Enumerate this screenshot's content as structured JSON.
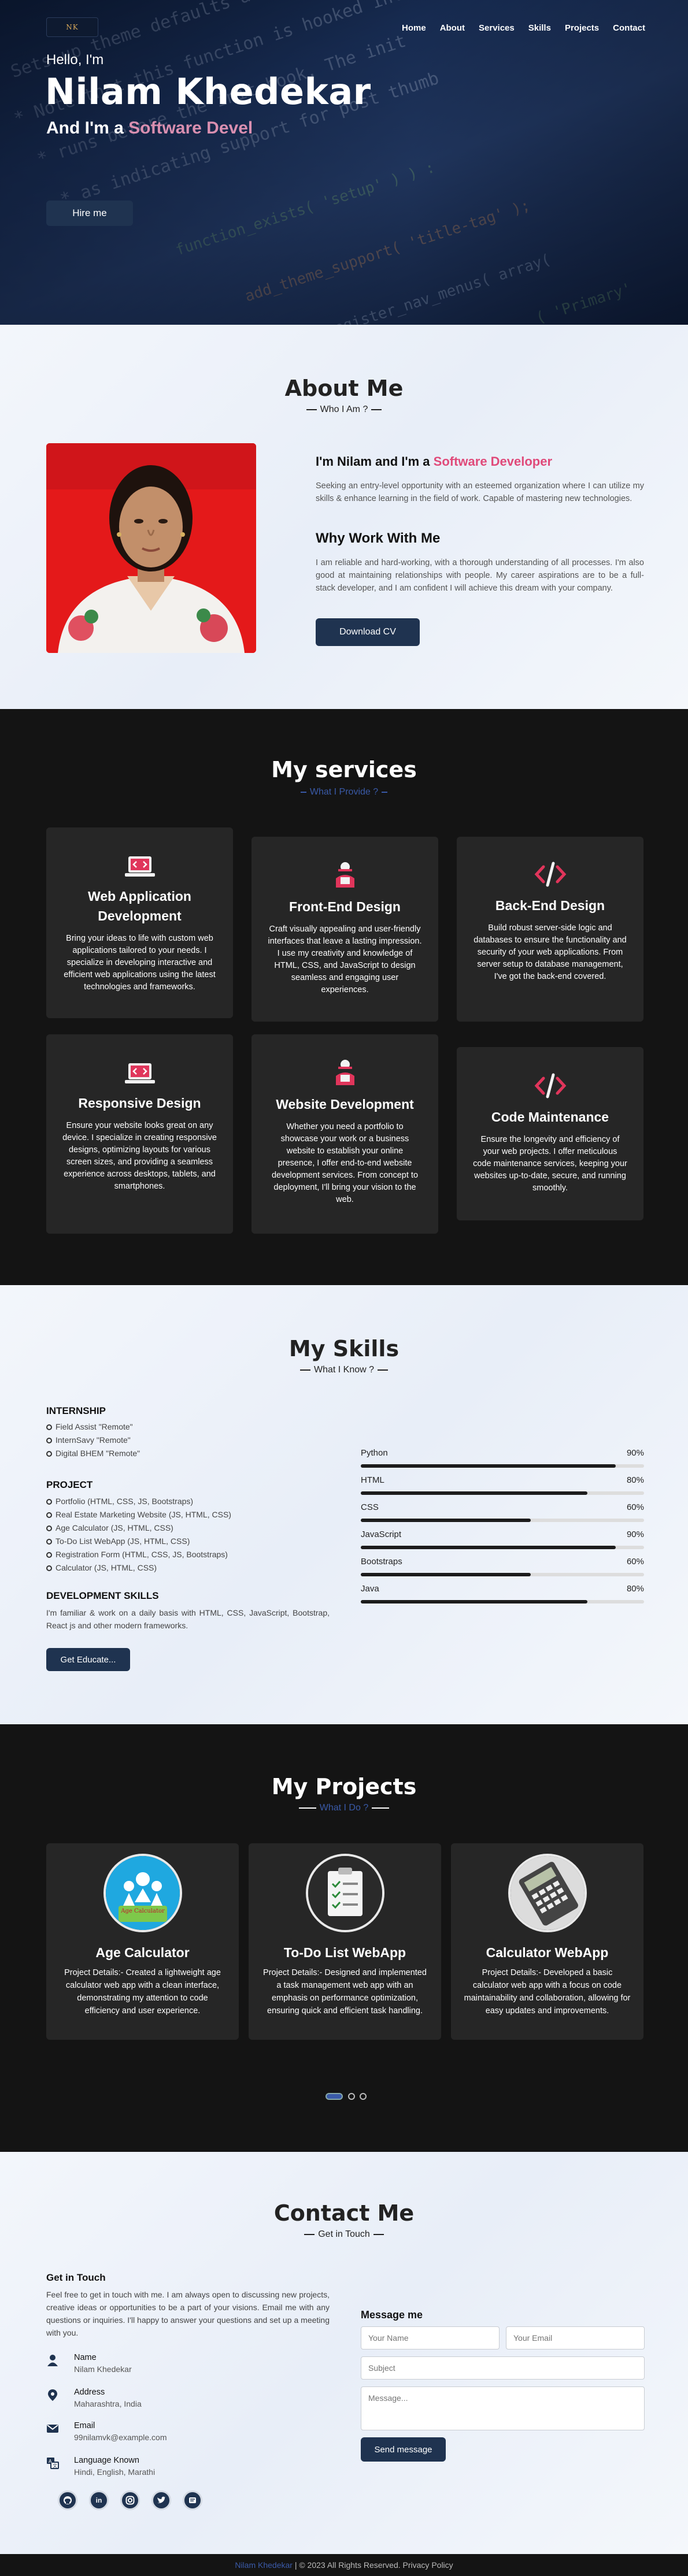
{
  "nav": {
    "logo_text": "NK",
    "items": [
      "Home",
      "About",
      "Services",
      "Skills",
      "Projects",
      "Contact"
    ]
  },
  "hero": {
    "greeting": "Hello, I'm",
    "name": "Nilam Khedekar",
    "role_prefix": "And I'm a ",
    "role_typed": "Software Devel",
    "hire_label": "Hire me"
  },
  "about": {
    "title": "About Me",
    "subtitle": "Who I Am ?",
    "intro_prefix": "I'm Nilam and I'm a ",
    "intro_typed": "Software Developer",
    "intro_p": "Seeking an entry-level opportunity with an esteemed organization where I can utilize my skills & enhance learning in the field of work. Capable of mastering new technologies.",
    "why_title": "Why Work With Me",
    "why_p": "I am reliable and hard-working, with a thorough understanding of all processes. I'm also good at maintaining relationships with people. My career aspirations are to be a full-stack developer, and I am confident I will achieve this dream with your company.",
    "cv_label": "Download CV"
  },
  "services": {
    "title": "My services",
    "subtitle": "What I Provide ?",
    "accent": "#3a5aa8",
    "items": [
      {
        "title": "Web Application Development",
        "desc": "Bring your ideas to life with custom web applications tailored to your needs. I specialize in developing interactive and efficient web applications using the latest technologies and frameworks.",
        "icon": "laptop-code-icon"
      },
      {
        "title": "Front-End Design",
        "desc": "Craft visually appealing and user-friendly interfaces that leave a lasting impression. I use my creativity and knowledge of HTML, CSS, and JavaScript to design seamless and engaging user experiences.",
        "icon": "designer-icon"
      },
      {
        "title": "Back-End Design",
        "desc": "Build robust server-side logic and databases to ensure the functionality and security of your web applications. From server setup to database management, I've got the back-end covered.",
        "icon": "code-icon"
      },
      {
        "title": "Responsive Design",
        "desc": "Ensure your website looks great on any device. I specialize in creating responsive designs, optimizing layouts for various screen sizes, and providing a seamless experience across desktops, tablets, and smartphones.",
        "icon": "laptop-code-icon"
      },
      {
        "title": "Website Development",
        "desc": "Whether you need a portfolio to showcase your work or a business website to establish your online presence, I offer end-to-end website development services. From concept to deployment, I'll bring your vision to the web.",
        "icon": "designer-icon"
      },
      {
        "title": "Code Maintenance",
        "desc": "Ensure the longevity and efficiency of your web projects. I offer meticulous code maintenance services, keeping your websites up-to-date, secure, and running smoothly.",
        "icon": "code-icon"
      }
    ]
  },
  "skills": {
    "title": "My Skills",
    "subtitle": "What I Know ?",
    "internship_title": "INTERNSHIP",
    "internships": [
      "Field Assist \"Remote\"",
      "InternSavy \"Remote\"",
      "Digital BHEM \"Remote\""
    ],
    "project_title": "PROJECT",
    "projects": [
      "Portfolio (HTML, CSS, JS, Bootstraps)",
      "Real Estate Marketing Website (JS, HTML, CSS)",
      "Age Calculator (JS, HTML, CSS)",
      "To-Do List WebApp (JS, HTML, CSS)",
      "Registration Form (HTML, CSS, JS, Bootstraps)",
      "Calculator (JS, HTML, CSS)"
    ],
    "dev_title": "DEVELOPMENT SKILLS",
    "dev_p": "I'm familiar & work on a daily basis with HTML, CSS, JavaScript, Bootstrap, React js and other modern frameworks.",
    "educate_label": "Get Educate...",
    "bars": [
      {
        "name": "Python",
        "label": "90%",
        "value": 0.9
      },
      {
        "name": "HTML",
        "label": "80%",
        "value": 0.8
      },
      {
        "name": "CSS",
        "label": "60%",
        "value": 0.6
      },
      {
        "name": "JavaScript",
        "label": "90%",
        "value": 0.9
      },
      {
        "name": "Bootstraps",
        "label": "60%",
        "value": 0.6
      },
      {
        "name": "Java",
        "label": "80%",
        "value": 0.8
      }
    ]
  },
  "projects": {
    "title": "My Projects",
    "subtitle": "What I Do ?",
    "items": [
      {
        "title": "Age Calculator",
        "desc": "Project Details:- Created a lightweight age calculator web app with a clean interface, demonstrating my attention to code efficiency and user experience.",
        "image_text": "Age Calculator"
      },
      {
        "title": "To-Do List WebApp",
        "desc": "Project Details:- Designed and implemented a task management web app with an emphasis on performance optimization, ensuring quick and efficient task handling."
      },
      {
        "title": "Calculator WebApp",
        "desc": "Project Details:- Developed a basic calculator web app with a focus on code maintainability and collaboration, allowing for easy updates and improvements."
      }
    ],
    "dots_active": 0
  },
  "contact": {
    "title": "Contact Me",
    "subtitle": "Get in Touch",
    "touch_title": "Get in Touch",
    "touch_p": "Feel free to get in touch with me. I am always open to discussing new projects, creative ideas or opportunities to be a part of your visions. Email me with any questions or inquiries. I'll happy to answer your questions and set up a meeting with you.",
    "info": [
      {
        "title": "Name",
        "value": "Nilam Khedekar",
        "icon": "person-icon"
      },
      {
        "title": "Address",
        "value": "Maharashtra, India",
        "icon": "map-pin-icon"
      },
      {
        "title": "Email",
        "value": "99nilamvk@example.com",
        "icon": "envelope-icon"
      },
      {
        "title": "Language Known",
        "value": "Hindi, English, Marathi",
        "icon": "language-icon"
      }
    ],
    "socials": [
      "github-icon",
      "linkedin-icon",
      "instagram-icon",
      "twitter-icon",
      "bookmark-icon"
    ],
    "message_title": "Message me",
    "placeholders": {
      "name": "Your Name",
      "email": "Your Email",
      "subject": "Subject",
      "message": "Message..."
    },
    "send_label": "Send message"
  },
  "footer": {
    "link_text": "Nilam Khedekar",
    "rest": " | © 2023 All Rights Reserved. Privacy Policy"
  }
}
